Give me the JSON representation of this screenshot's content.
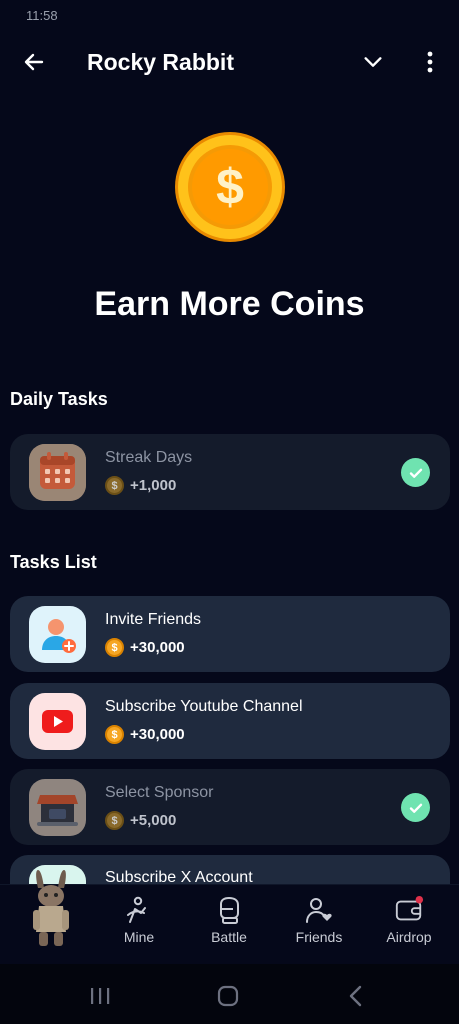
{
  "status_bar": {
    "time": "11:58"
  },
  "header": {
    "title": "Rocky Rabbit"
  },
  "hero": {
    "title": "Earn More Coins"
  },
  "daily": {
    "section_title": "Daily Tasks",
    "tasks": [
      {
        "title": "Streak Days",
        "reward": "+1,000",
        "completed": true
      }
    ]
  },
  "tasks_list": {
    "section_title": "Tasks List",
    "tasks": [
      {
        "title": "Invite Friends",
        "reward": "+30,000",
        "completed": false
      },
      {
        "title": "Subscribe Youtube Channel",
        "reward": "+30,000",
        "completed": false
      },
      {
        "title": "Select Sponsor",
        "reward": "+5,000",
        "completed": true
      },
      {
        "title": "Subscribe X Account"
      }
    ]
  },
  "coin_symbol": "$",
  "bottom_nav": {
    "items": [
      {
        "label": "Mine"
      },
      {
        "label": "Battle"
      },
      {
        "label": "Friends"
      },
      {
        "label": "Airdrop"
      }
    ]
  },
  "colors": {
    "background": "#05081a",
    "card": "#1f2a3e",
    "check": "#6fe3b0",
    "coin": "#f6a623"
  }
}
